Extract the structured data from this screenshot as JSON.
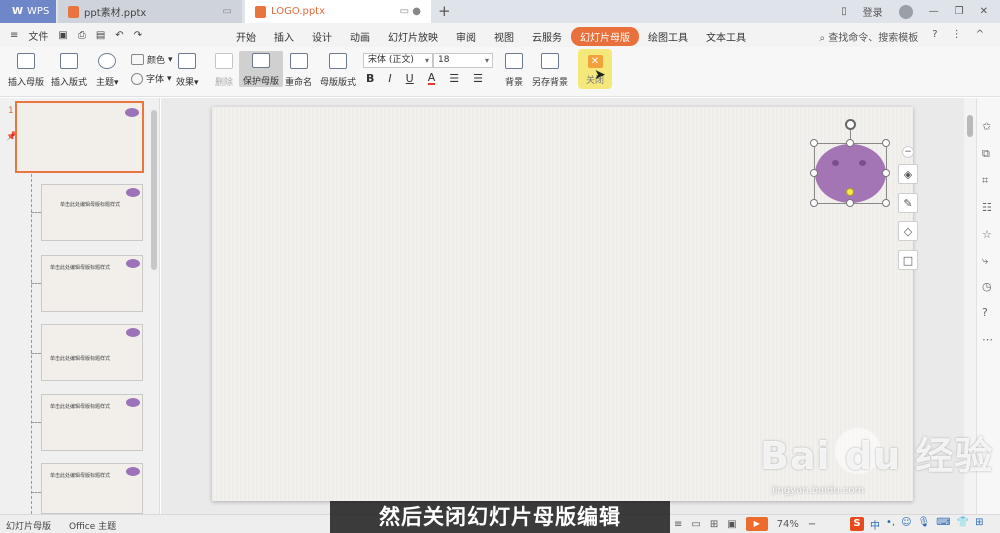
{
  "titlebar": {
    "tabs": [
      {
        "label": "WPS"
      },
      {
        "label": "ppt素材.pptx"
      },
      {
        "label": "LOGO.pptx"
      }
    ],
    "new_tab": "+",
    "login": "登录"
  },
  "menubar": {
    "file": "文件",
    "tabs": [
      "开始",
      "插入",
      "设计",
      "动画",
      "幻灯片放映",
      "审阅",
      "视图",
      "云服务",
      "幻灯片母版",
      "绘图工具",
      "文本工具"
    ],
    "active_tab": "幻灯片母版",
    "search": "查找命令、搜索模板",
    "help": "?"
  },
  "ribbon": {
    "insert_master": "插入母版",
    "insert_layout": "插入版式",
    "theme": "主题",
    "colors": "颜色",
    "fonts": "字体",
    "effects": "效果",
    "delete": "删除",
    "protect_master": "保护母版",
    "rename": "重命名",
    "master_layout": "母版版式",
    "font_name": "宋体 (正文)",
    "font_size": "18",
    "background": "背景",
    "save_background": "另存背景",
    "close": "关闭"
  },
  "slides_panel": {
    "first_number": "1",
    "thumbs": [
      {
        "title": ""
      },
      {
        "title": "单击此处编辑母版标题样式"
      },
      {
        "title": "单击此处编辑母版标题样式"
      },
      {
        "title": "单击此处编辑母版标题样式"
      },
      {
        "title": "单击此处编辑母版标题样式"
      },
      {
        "title": "单击此处编辑母版标题样式"
      }
    ]
  },
  "statusbar": {
    "mode": "幻灯片母版",
    "theme": "Office 主题",
    "zoom": "74%",
    "ime": "中"
  },
  "subtitle": "然后关闭幻灯片母版编辑",
  "watermark": {
    "main": "Bai du 经验",
    "url": "jingyan.baidu.com"
  },
  "colors": {
    "accent": "#e9703a",
    "logo": "#a475b4"
  }
}
